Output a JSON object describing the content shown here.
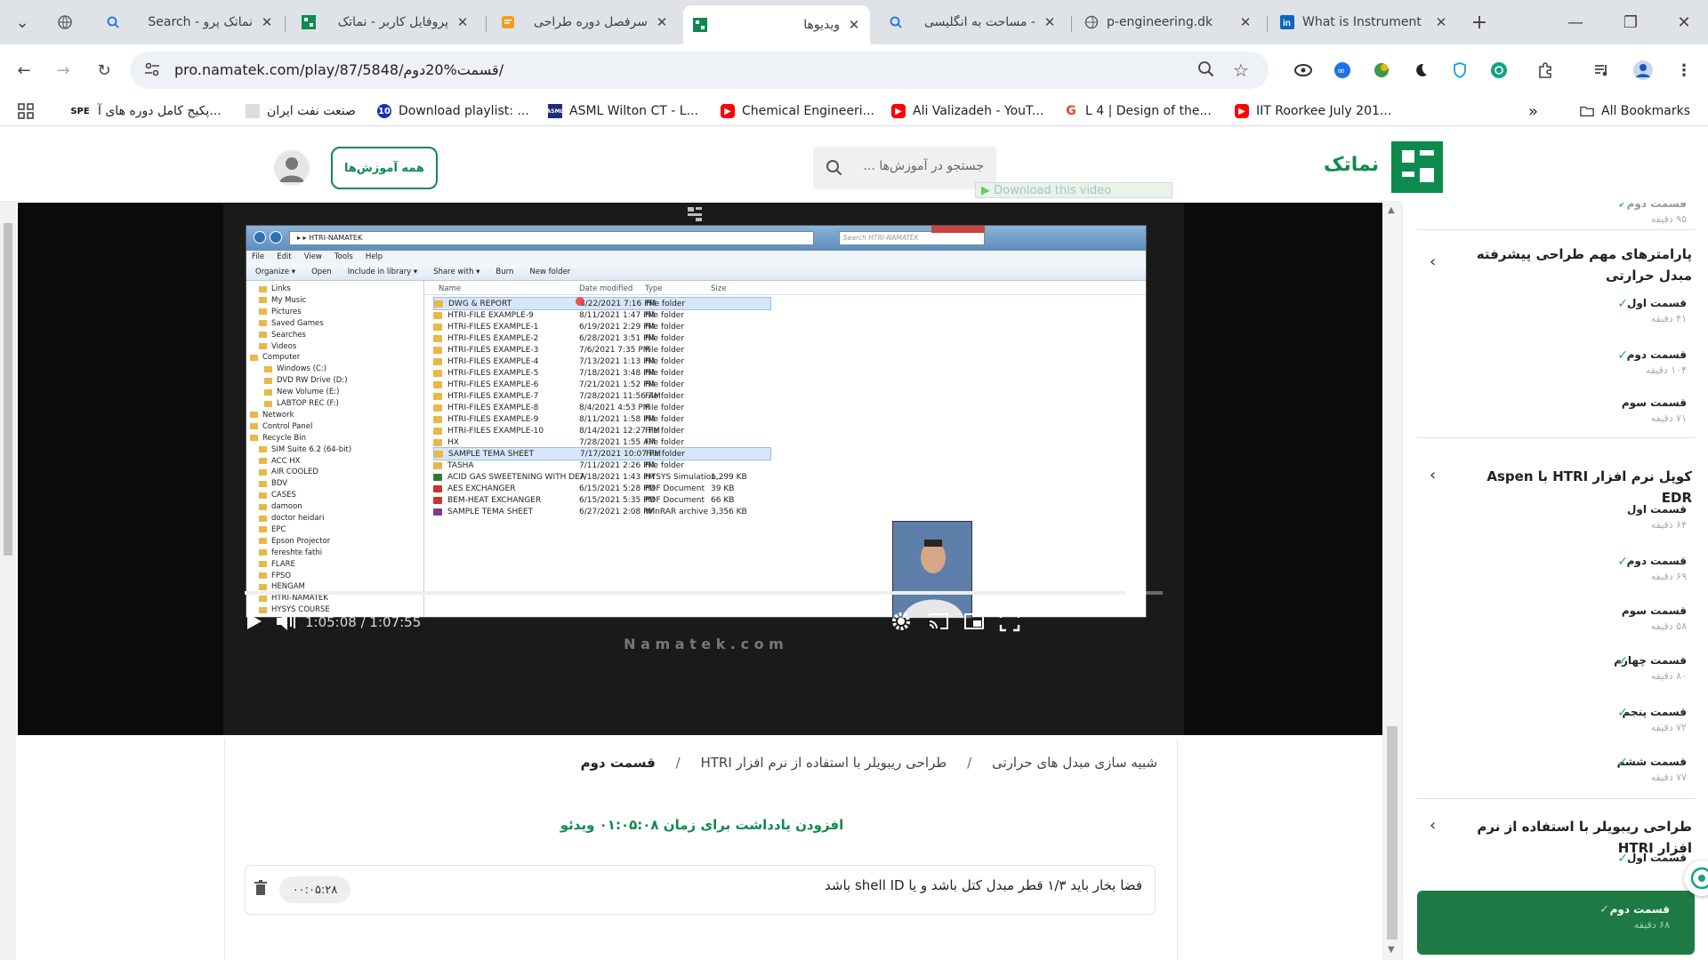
{
  "browser": {
    "tabs": [
      {
        "title": "Search - نماتک پرو",
        "icon": "search-icon"
      },
      {
        "title": "پروفایل کاربر - نماتک",
        "icon": "namatek-icon"
      },
      {
        "title": "سرفصل دوره طراحی",
        "icon": "doc-icon"
      },
      {
        "title": "ویدیوها",
        "icon": "namatek-icon",
        "active": true
      },
      {
        "title": "مساحت به انگلیسی -",
        "icon": "search-icon"
      },
      {
        "title": "p-engineering.dk",
        "icon": "globe-icon"
      },
      {
        "title": "What is Instrument",
        "icon": "linkedin-icon"
      }
    ],
    "url": "pro.namatek.com/play/87/5848/قسمت%20دوم/",
    "bookmarks": [
      {
        "label": "پکیج کامل دوره های آ...",
        "badge": "SPE"
      },
      {
        "label": "صنعت نفت ایران",
        "badge": ""
      },
      {
        "label": "Download playlist: ...",
        "badge": "10"
      },
      {
        "label": "ASML Wilton CT - L...",
        "badge": "ASML"
      },
      {
        "label": "Chemical Engineeri...",
        "badge": ""
      },
      {
        "label": "Ali Valizadeh - YouT...",
        "badge": ""
      },
      {
        "label": "L 4 | Design of the...",
        "badge": "G"
      },
      {
        "label": "IIT Roorkee July 201...",
        "badge": ""
      }
    ],
    "all_bookmarks": "All Bookmarks"
  },
  "site": {
    "logo_text": "نماتک",
    "search_placeholder": "جستجو در آموزش‌ها ...",
    "all_courses": "همه آموزش‌ها",
    "download_video": "Download this video"
  },
  "player": {
    "current_time": "1:05:08",
    "duration": "1:07:55",
    "progress": 0.959,
    "watermark": "N a m a t e k . c o m"
  },
  "explorer": {
    "path": "HTRI-NAMATEK",
    "search_placeholder": "Search HTRI-NAMATEK",
    "menu": [
      "File",
      "Edit",
      "View",
      "Tools",
      "Help"
    ],
    "toolbar": [
      "Organize ▾",
      "Open",
      "Include in library ▾",
      "Share with ▾",
      "Burn",
      "New folder"
    ],
    "columns": [
      "Name",
      "Date modified",
      "Type",
      "Size"
    ],
    "files": [
      {
        "name": "DWG & REPORT",
        "date": "8/22/2021 7:16 PM",
        "type": "File folder",
        "size": ""
      },
      {
        "name": "HTRI-FILE EXAMPLE-9",
        "date": "8/11/2021 1:47 PM",
        "type": "File folder",
        "size": ""
      },
      {
        "name": "HTRI-FILES EXAMPLE-1",
        "date": "6/19/2021 2:29 PM",
        "type": "File folder",
        "size": ""
      },
      {
        "name": "HTRI-FILES EXAMPLE-2",
        "date": "6/28/2021 3:51 PM",
        "type": "File folder",
        "size": ""
      },
      {
        "name": "HTRI-FILES EXAMPLE-3",
        "date": "7/6/2021 7:35 PM",
        "type": "File folder",
        "size": ""
      },
      {
        "name": "HTRI-FILES EXAMPLE-4",
        "date": "7/13/2021 1:13 PM",
        "type": "File folder",
        "size": ""
      },
      {
        "name": "HTRI-FILES EXAMPLE-5",
        "date": "7/18/2021 3:48 PM",
        "type": "File folder",
        "size": ""
      },
      {
        "name": "HTRI-FILES EXAMPLE-6",
        "date": "7/21/2021 1:52 PM",
        "type": "File folder",
        "size": ""
      },
      {
        "name": "HTRI-FILES EXAMPLE-7",
        "date": "7/28/2021 11:56 AM",
        "type": "File folder",
        "size": ""
      },
      {
        "name": "HTRI-FILES EXAMPLE-8",
        "date": "8/4/2021 4:53 PM",
        "type": "File folder",
        "size": ""
      },
      {
        "name": "HTRI-FILES EXAMPLE-9",
        "date": "8/11/2021 1:58 PM",
        "type": "File folder",
        "size": ""
      },
      {
        "name": "HTRI-FILES EXAMPLE-10",
        "date": "8/14/2021 12:27 PM",
        "type": "File folder",
        "size": ""
      },
      {
        "name": "HX",
        "date": "7/28/2021 1:55 AM",
        "type": "File folder",
        "size": ""
      },
      {
        "name": "SAMPLE TEMA SHEET",
        "date": "7/17/2021 10:07 PM",
        "type": "File folder",
        "size": ""
      },
      {
        "name": "TASHA",
        "date": "7/11/2021 2:26 PM",
        "type": "File folder",
        "size": ""
      },
      {
        "name": "ACID GAS SWEETENING WITH DEA",
        "date": "7/18/2021 1:43 PM",
        "type": "HYSYS Simulation...",
        "size": "1,299 KB"
      },
      {
        "name": "AES EXCHANGER",
        "date": "6/15/2021 5:28 PM",
        "type": "PDF Document",
        "size": "39 KB"
      },
      {
        "name": "BEM-HEAT EXCHANGER",
        "date": "6/15/2021 5:35 PM",
        "type": "PDF Document",
        "size": "66 KB"
      },
      {
        "name": "SAMPLE TEMA SHEET",
        "date": "6/27/2021 2:08 PM",
        "type": "WinRAR archive",
        "size": "3,356 KB"
      }
    ],
    "tree": [
      "Links",
      "My Music",
      "Pictures",
      "Saved Games",
      "Searches",
      "Videos",
      "Computer",
      "Windows (C:)",
      "DVD RW Drive (D:)",
      "New Volume (E:)",
      "LABTOP REC (F:)",
      "Network",
      "Control Panel",
      "Recycle Bin",
      "SIM Suite 6.2 (64-bit)",
      "ACC HX",
      "AIR COOLED",
      "BDV",
      "CASES",
      "damoon",
      "doctor heidari",
      "EPC",
      "Epson Projector",
      "fereshte fathi",
      "FLARE",
      "FPSO",
      "HENGAM",
      "HTRI-NAMATEK",
      "HYSYS COURSE"
    ]
  },
  "content": {
    "breadcrumb": [
      "شبیه سازی مبدل های حرارتی",
      "طراحی ریبویلر با استفاده از نرم افزار HTRI",
      "قسمت دوم"
    ],
    "add_note": "افزودن یادداشت برای زمان ۰۱:۰۵:۰۸ ویدئو",
    "note_text": "فضا بخار باید ۱/۳ قطر مبدل کتل باشد و یا shell ID باشد",
    "note_time": "۰۰:۰۵:۲۸"
  },
  "sidebar": {
    "top_item": {
      "name": "قسمت دوم",
      "duration": "۹۵ دقیقه"
    },
    "sections": [
      {
        "title": "پارامترهای مهم طراحی پیشرفته مبدل حرارتی",
        "episodes": [
          {
            "name": "قسمت اول",
            "duration": "۴۱ دقیقه",
            "done": true
          },
          {
            "name": "قسمت دوم",
            "duration": "۱۰۴ دقیقه",
            "done": true
          },
          {
            "name": "قسمت سوم",
            "duration": "۷۱ دقیقه",
            "done": false
          }
        ]
      },
      {
        "title": "کوپل نرم افزار HTRI با Aspen EDR",
        "episodes": [
          {
            "name": "قسمت اول",
            "duration": "۶۴ دقیقه",
            "done": false
          },
          {
            "name": "قسمت دوم",
            "duration": "۶۹ دقیقه",
            "done": true
          },
          {
            "name": "قسمت سوم",
            "duration": "۵۸ دقیقه",
            "done": false
          },
          {
            "name": "قسمت چهارم",
            "duration": "۸۰ دقیقه",
            "done": true
          },
          {
            "name": "قسمت پنجم",
            "duration": "۷۲ دقیقه",
            "done": true
          },
          {
            "name": "قسمت ششم",
            "duration": "۷۷ دقیقه",
            "done": true
          }
        ]
      },
      {
        "title": "طراحی ریبویلر با استفاده از نرم افزار HTRI",
        "episodes": [
          {
            "name": "قسمت اول",
            "duration": "",
            "done": true
          },
          {
            "name": "قسمت دوم",
            "duration": "۶۸ دقیقه",
            "done": true,
            "active": true
          }
        ]
      }
    ]
  },
  "colors": {
    "brand": "#0f8a4f",
    "active_episode": "#1e7a45",
    "tabstrip": "#dfe3e8"
  }
}
